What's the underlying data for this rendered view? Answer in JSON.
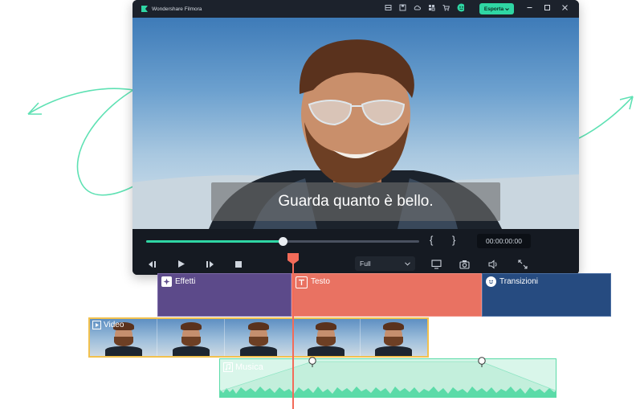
{
  "app": {
    "title": "Wondershare Filmora",
    "export_label": "Esporta"
  },
  "titlebar_icons": [
    "layout-icon",
    "save-icon",
    "cloud-icon",
    "grid-icon",
    "cart-icon",
    "avatar-icon"
  ],
  "preview": {
    "subtitle": "Guarda quanto è bello."
  },
  "playback": {
    "progress_percent": 50,
    "mark_in": "{",
    "mark_out": "}",
    "timecode": "00:00:00:00",
    "quality": "Full"
  },
  "tracks": {
    "effects_label": "Effetti",
    "text_label": "Testo",
    "transitions_label": "Transizioni",
    "video_label": "Video",
    "music_label": "Musica"
  },
  "colors": {
    "accent": "#2fd6a4",
    "effects": "#5c4a8a",
    "text": "#e97262",
    "transitions": "#264b80",
    "video_border": "#f2c14e",
    "music": "#d9f6ea",
    "playhead": "#f36b59"
  }
}
